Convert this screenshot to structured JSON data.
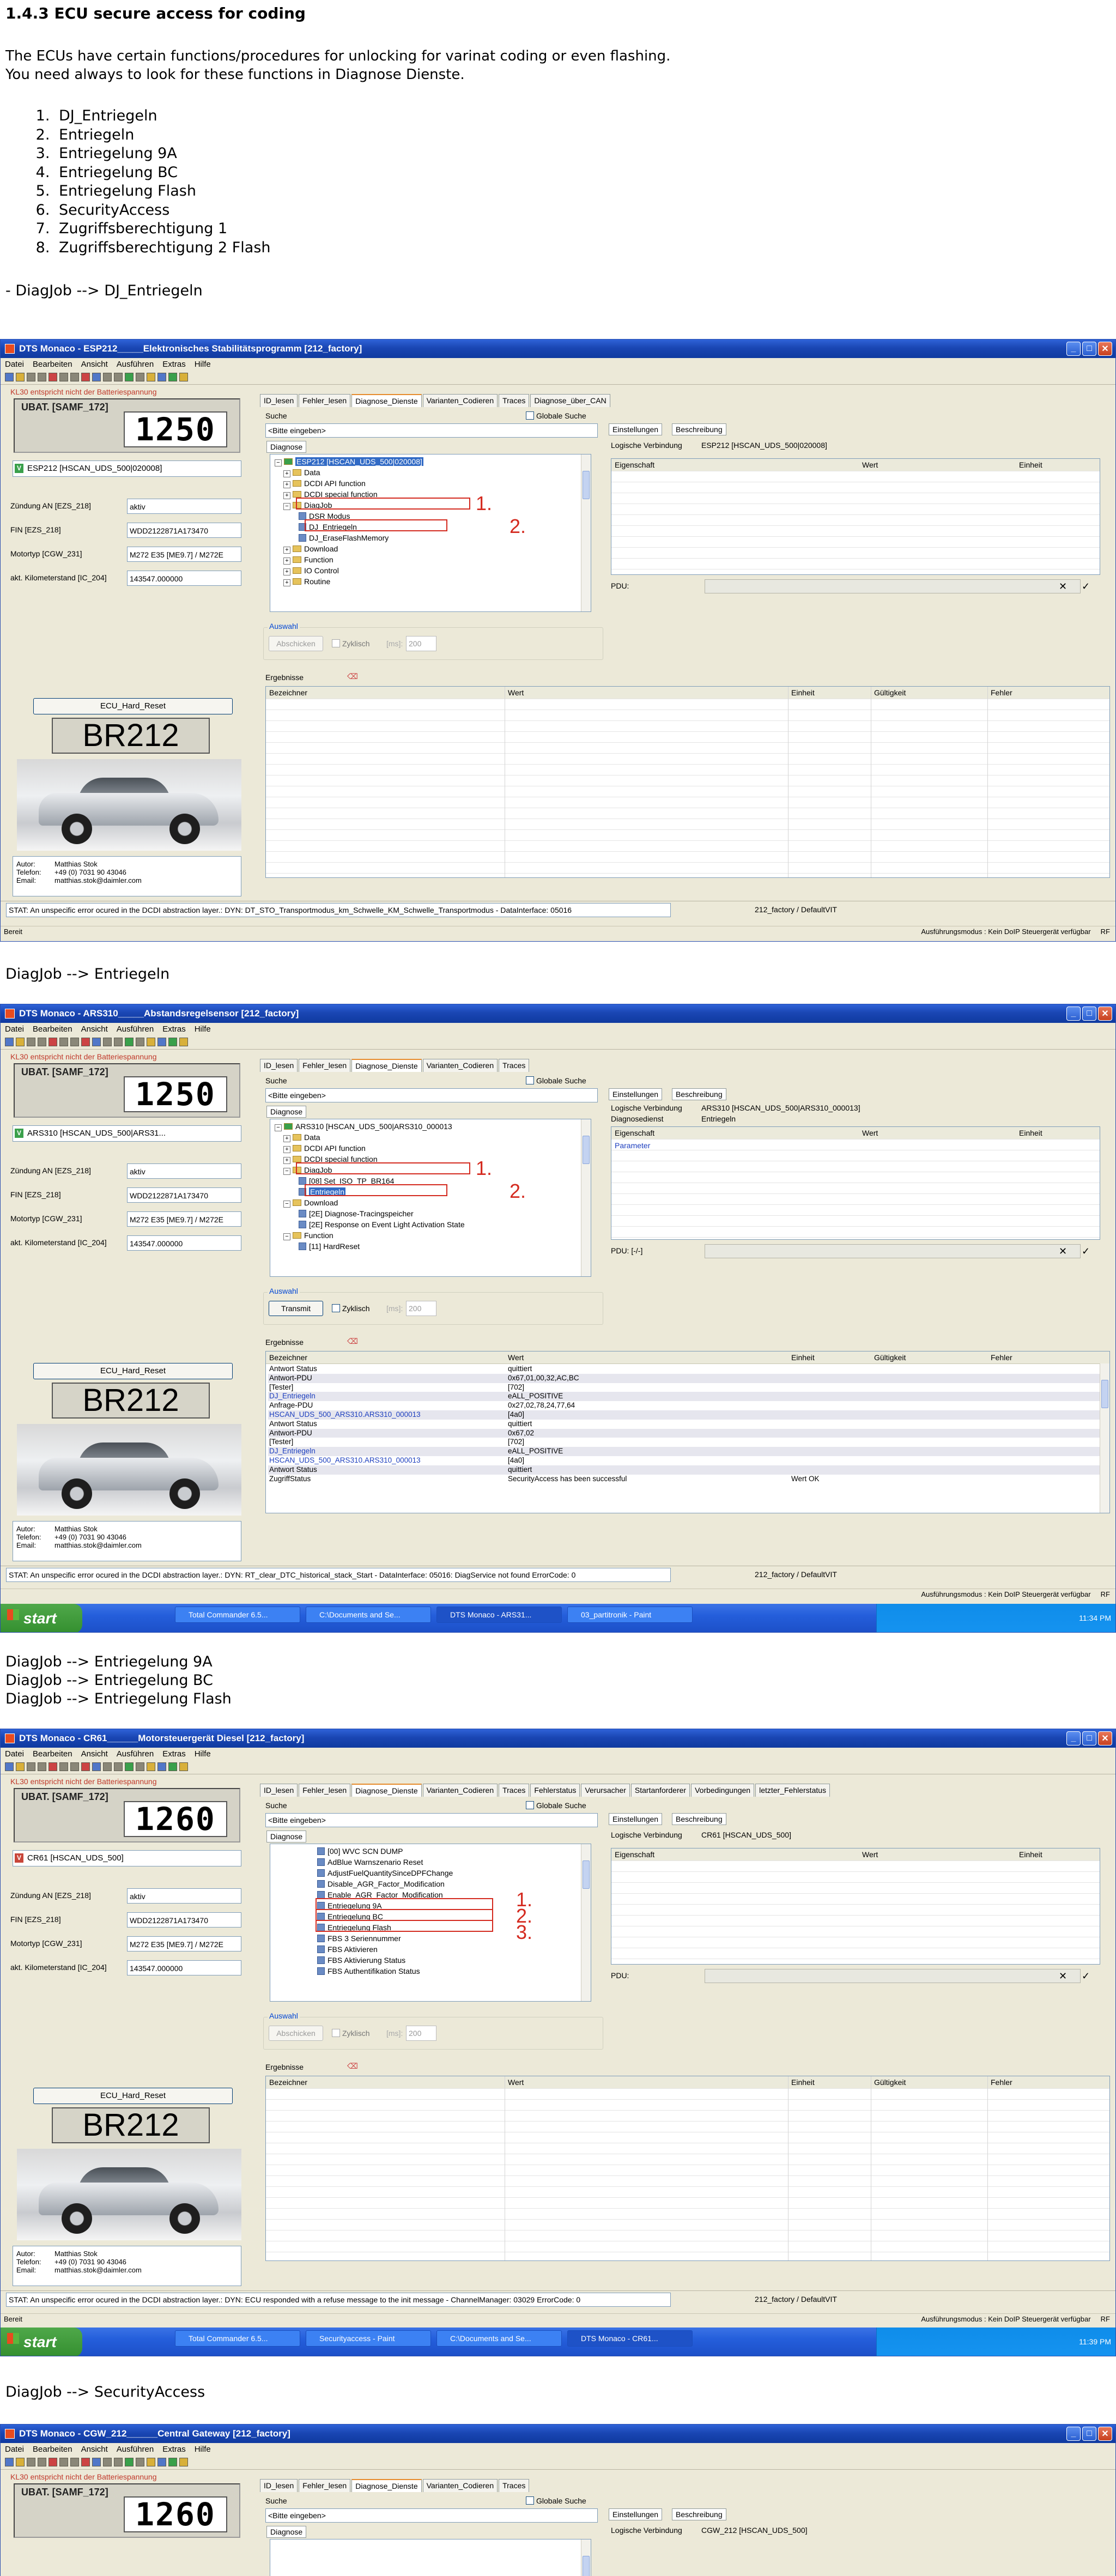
{
  "heading": "1.4.3 ECU secure access for coding",
  "intro": {
    "line1": "The ECUs have certain functions/procedures for unlocking for varinat coding or even flashing.",
    "line2": "You need always to look for these functions in Diagnose Dienste."
  },
  "function_list": [
    "DJ_Entriegeln",
    "Entriegeln",
    "Entriegelung 9A",
    "Entriegelung BC",
    "Entriegelung Flash",
    "SecurityAccess",
    "Zugriffsberechtigung 1",
    "Zugriffsberechtigung 2 Flash"
  ],
  "captions": {
    "c1": "- DiagJob --> DJ_Entriegeln",
    "c2": "DiagJob --> Entriegeln",
    "c3a": "DiagJob --> Entriegelung 9A",
    "c3b": "DiagJob --> Entriegelung BC",
    "c3c": "DiagJob --> Entriegelung Flash",
    "c4": "DiagJob --> SecurityAccess"
  },
  "common": {
    "menu": [
      "Datei",
      "Bearbeiten",
      "Ansicht",
      "Ausführen",
      "Extras",
      "Hilfe"
    ],
    "battery_warning": "KL30 entspricht nicht der Batteriespannung",
    "ubat_label": "UBAT. [SAMF_172]",
    "kv_labels": [
      "Zündung AN [EZS_218]",
      "FIN [EZS_218]",
      "Motortyp [CGW_231]",
      "akt. Kilometerstand [IC_204]"
    ],
    "kv_values": [
      "aktiv",
      "WDD2122871A173470",
      "M272 E35 [ME9.7] / M272E",
      "143547.000000"
    ],
    "hard_reset": "ECU_Hard_Reset",
    "model": "BR212",
    "author_label": "Autor:",
    "author": "Matthias Stok",
    "phone_label": "Telefon:",
    "phone": "+49 (0) 7031 90 43046",
    "email_label": "Email:",
    "email": "matthias.stok@daimler.com",
    "search_label": "Suche",
    "search_placeholder": "<Bitte eingeben>",
    "global_search": "Globale Suche",
    "diag_tab": "Diagnose",
    "settings_tab": "Einstellungen",
    "desc_tab": "Beschreibung",
    "prop_cols": [
      "Eigenschaft",
      "Wert",
      "Einheit"
    ],
    "pdu_label": "PDU:",
    "auswahl": "Auswahl",
    "abschicken": "Abschicken",
    "transmit": "Transmit",
    "zyklisch": "Zyklisch",
    "ms": "[ms]:",
    "interval": "200",
    "ergebnisse": "Ergebnisse",
    "result_cols": [
      "Bezeichner",
      "Wert",
      "Einheit",
      "Gültigkeit",
      "Fehler"
    ],
    "status_right": "212_factory / DefaultVIT",
    "ready": "Bereit",
    "mode": "Ausführungsmodus : Kein DoIP Steuergerät verfügbar",
    "rf": "RF"
  },
  "win1": {
    "title": "DTS Monaco  -  ESP212_____Elektronisches Stabilitätsprogramm [212_factory]",
    "ecu": "ESP212 [HSCAN_UDS_500|020008]",
    "tabs": [
      "ID_lesen",
      "Fehler_lesen",
      "Diagnose_Dienste",
      "Varianten_Codieren",
      "Traces",
      "Diagnose_über_CAN"
    ],
    "logical": "Logische Verbindung",
    "logical_val": "ESP212 [HSCAN_UDS_500|020008]",
    "tree": [
      "ESP212 [HSCAN_UDS_500|020008]",
      "Data",
      "DCDI API function",
      "DCDI special function",
      "DiagJob",
      "DSR Modus",
      "DJ_Entriegeln",
      "DJ_EraseFlashMemory",
      "Download",
      "Function",
      "IO Control",
      "Routine"
    ],
    "status": "STAT: An unspecific error ocured in the DCDI abstraction layer.: DYN: DT_STO_Transportmodus_km_Schwelle_KM_Schwelle_Transportmodus - DataInterface: 05016"
  },
  "win2": {
    "title": "DTS Monaco  -  ARS310_____Abstandsregelsensor [212_factory]",
    "ecu": "ARS310 [HSCAN_UDS_500|ARS31...",
    "tabs": [
      "ID_lesen",
      "Fehler_lesen",
      "Diagnose_Dienste",
      "Varianten_Codieren",
      "Traces"
    ],
    "logical": "Logische Verbindung",
    "logical_val": "ARS310 [HSCAN_UDS_500|ARS310_000013]",
    "service_label": "Diagnosedienst",
    "service_val": "Entriegeln",
    "param": "Parameter",
    "pdu_val": "PDU: [-/-]",
    "tree": [
      "ARS310 [HSCAN_UDS_500|ARS310_000013",
      "Data",
      "DCDI API function",
      "DCDI special function",
      "DiagJob",
      "[08] Set_ISO_TP_BR164",
      "Entriegeln",
      "Download",
      "[2E] Diagnose-Tracingspeicher",
      "[2E] Response on Event Light Activation State",
      "Function",
      "[11] HardReset"
    ],
    "results": [
      [
        "Antwort Status",
        "quittiert",
        "",
        ""
      ],
      [
        "Antwort-PDU",
        "0x67,01,00,32,AC,BC",
        "",
        ""
      ],
      [
        "[Tester]",
        "[702]",
        "",
        ""
      ],
      [
        "DJ_Entriegeln",
        "eALL_POSITIVE",
        "",
        ""
      ],
      [
        "Anfrage-PDU",
        "0x27,02,78,24,77,64",
        "",
        ""
      ],
      [
        "HSCAN_UDS_500_ARS310.ARS310_000013",
        "[4a0]",
        "",
        ""
      ],
      [
        "Antwort Status",
        "quittiert",
        "",
        ""
      ],
      [
        "Antwort-PDU",
        "0x67,02",
        "",
        ""
      ],
      [
        "[Tester]",
        "[702]",
        "",
        ""
      ],
      [
        "DJ_Entriegeln",
        "eALL_POSITIVE",
        "",
        ""
      ],
      [
        "HSCAN_UDS_500_ARS310.ARS310_000013",
        "[4a0]",
        "",
        ""
      ],
      [
        "Antwort Status",
        "quittiert",
        "",
        ""
      ],
      [
        "ZugriffStatus",
        "SecurityAccess has been successful",
        "Wert OK",
        ""
      ]
    ],
    "status": "STAT: An unspecific error ocured in the DCDI abstraction layer.: DYN: RT_clear_DTC_historical_stack_Start - DataInterface: 05016: DiagService not found ErrorCode: 0",
    "taskbar": [
      "Total Commander 6.5...",
      "C:\\Documents and Se...",
      "DTS Monaco - ARS31...",
      "03_partitronik - Paint"
    ],
    "clock": "11:34 PM",
    "start": "start"
  },
  "win3": {
    "title": "DTS Monaco  -  CR61______Motorsteuergerät Diesel [212_factory]",
    "ecu": "CR61 [HSCAN_UDS_500]",
    "tabs": [
      "ID_lesen",
      "Fehler_lesen",
      "Diagnose_Dienste",
      "Varianten_Codieren",
      "Traces",
      "Fehlerstatus",
      "Verursacher",
      "Startanforderer",
      "Vorbedingungen",
      "letzter_Fehlerstatus"
    ],
    "logical": "Logische Verbindung",
    "logical_val": "CR61 [HSCAN_UDS_500]",
    "tree": [
      "[00] WVC SCN DUMP",
      "AdBlue Warnszenario Reset",
      "AdjustFuelQuantitySinceDPFChange",
      "Disable_AGR_Factor_Modification",
      "Enable_AGR_Factor_Modification",
      "Entriegelung 9A",
      "Entriegelung BC",
      "Entriegelung Flash",
      "FBS 3 Seriennummer",
      "FBS Aktivieren",
      "FBS Aktivierung Status",
      "FBS Authentifikation Status"
    ],
    "status": "STAT: An unspecific error ocured in the DCDI abstraction layer.: DYN: ECU responded with a refuse message to the init message - ChannelManager: 03029 ErrorCode: 0",
    "taskbar": [
      "Total Commander 6.5...",
      "Securityaccess - Paint",
      "C:\\Documents and Se...",
      "DTS Monaco - CR61..."
    ],
    "clock": "11:39 PM",
    "start": "start"
  },
  "win4": {
    "title": "DTS Monaco  -  CGW_212______Central Gateway [212_factory]",
    "tabs": [
      "ID_lesen",
      "Fehler_lesen",
      "Diagnose_Dienste",
      "Varianten_Codieren",
      "Traces"
    ],
    "logical": "Logische Verbindung",
    "logical_val": "CGW_212 [HSCAN_UDS_500]"
  },
  "ubat_value": "1250",
  "ubat_value3": "1260",
  "annotations": [
    "1.",
    "2.",
    "3."
  ]
}
